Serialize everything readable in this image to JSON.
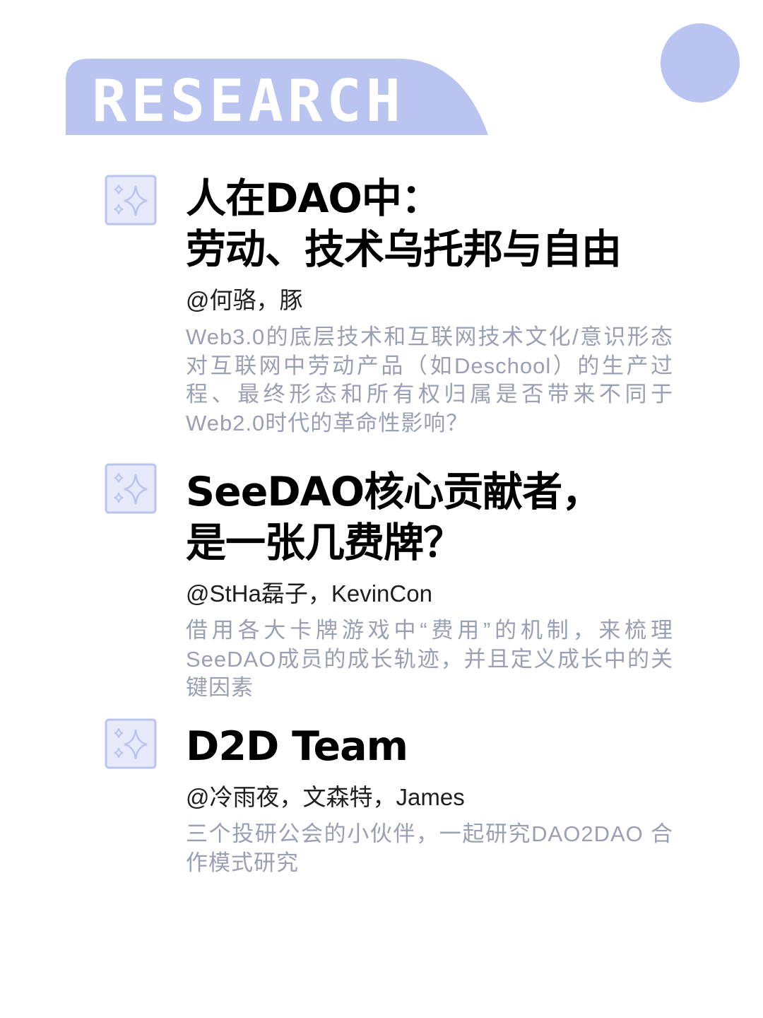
{
  "header": {
    "label": "RESEARCH",
    "accent_color": "#b9c4f1"
  },
  "items": [
    {
      "icon": "sparkle-icon",
      "title_lines": [
        "人在DAO中：",
        "劳动、技术乌托邦与自由"
      ],
      "authors": "@何骆，豚",
      "description": "Web3.0的底层技术和互联网技术文化/意识形态对互联网中劳动产品（如Deschool）的生产过程、最终形态和所有权归属是否带来不同于Web2.0时代的革命性影响？"
    },
    {
      "icon": "sparkle-icon",
      "title_lines": [
        "SeeDAO核心贡献者，",
        "是一张几费牌？"
      ],
      "authors": "@StHa磊子，KevinCon",
      "description": "借用各大卡牌游戏中“费用”的机制，来梳理SeeDAO成员的成长轨迹，并且定义成长中的关键因素"
    },
    {
      "icon": "sparkle-icon",
      "title_lines": [
        "D2D Team"
      ],
      "authors": "@冷雨夜，文森特，James",
      "description": "三个投研公会的小伙伴，一起研究DAO2DAO 合作模式研究"
    }
  ]
}
